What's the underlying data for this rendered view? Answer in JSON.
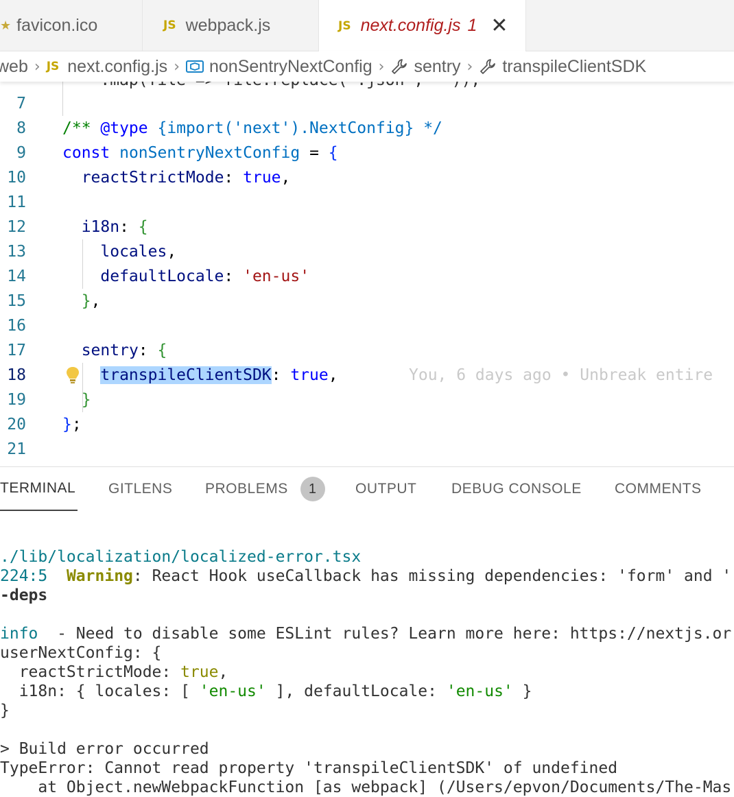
{
  "tabs": [
    {
      "name": "favicon.ico",
      "icon": "star-icon"
    },
    {
      "name": "webpack.js",
      "icon_label": "JS"
    },
    {
      "name": "next.config.js",
      "icon_label": "JS",
      "problems": "1",
      "active": true
    }
  ],
  "close_glyph": "✕",
  "breadcrumb": {
    "items": [
      "web",
      "next.config.js",
      "nonSentryNextConfig",
      "sentry",
      "transpileClientSDK"
    ],
    "js_label": "JS"
  },
  "editor": {
    "partial_top_line": "    .map(file => file.replace('.json', ''));",
    "lines": [
      {
        "n": "7"
      },
      {
        "n": "8",
        "text_a": "/** ",
        "text_tag": "@type",
        "text_b": " {import('next').NextConfig} */"
      },
      {
        "n": "9",
        "kw": "const",
        "name": "nonSentryNextConfig",
        "rest": " = "
      },
      {
        "n": "10",
        "prop": "reactStrictMode",
        "val": "true"
      },
      {
        "n": "11"
      },
      {
        "n": "12",
        "prop": "i18n"
      },
      {
        "n": "13",
        "prop": "locales"
      },
      {
        "n": "14",
        "prop": "defaultLocale",
        "val": "'en-us'"
      },
      {
        "n": "15"
      },
      {
        "n": "16"
      },
      {
        "n": "17",
        "prop": "sentry"
      },
      {
        "n": "18",
        "prop": "transpileClientSDK",
        "val": "true"
      },
      {
        "n": "19"
      },
      {
        "n": "20"
      },
      {
        "n": "21"
      }
    ],
    "blame": "You, 6 days ago • Unbreak entire"
  },
  "panel": {
    "tabs": [
      "TERMINAL",
      "GITLENS",
      "PROBLEMS",
      "OUTPUT",
      "DEBUG CONSOLE",
      "COMMENTS"
    ],
    "problems_count": "1"
  },
  "terminal": {
    "l1": "./lib/localization/localized-error.tsx",
    "l2_pos": "224:5",
    "l2_warn": "Warning",
    "l2_msg": ": React Hook useCallback has missing dependencies: 'form' and '",
    "l3": "-deps",
    "l4_info": "info",
    "l4_msg": "  - Need to disable some ESLint rules? Learn more here: https://nextjs.or",
    "l5": "userNextConfig: {",
    "l6_key": "  reactStrictMode: ",
    "l6_val": "true",
    "l6_end": ",",
    "l7_a": "  i18n: { locales: [ ",
    "l7_v1": "'en-us'",
    "l7_b": " ], defaultLocale: ",
    "l7_v2": "'en-us'",
    "l7_c": " }",
    "l8": "}",
    "l9": "> Build error occurred",
    "l10": "TypeError: Cannot read property 'transpileClientSDK' of undefined",
    "l11": "    at Object.newWebpackFunction [as webpack] (/Users/epvon/Documents/The-Mas"
  }
}
